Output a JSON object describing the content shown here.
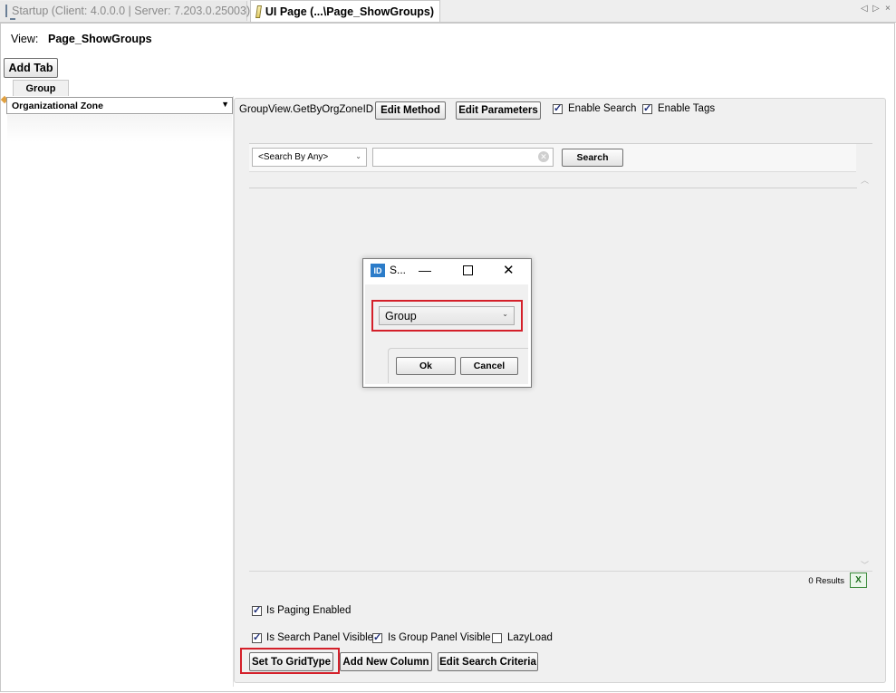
{
  "tabs": {
    "startup": "Startup (Client: 4.0.0.0 | Server: 7.203.0.25003)",
    "ui_page": "UI Page (...\\Page_ShowGroups)"
  },
  "view": {
    "label": "View:",
    "value": "Page_ShowGroups"
  },
  "add_tab": "Add Tab",
  "inner_tab": "Group",
  "org_zone": "Organizational Zone",
  "method": {
    "name": "GroupView.GetByOrgZoneID",
    "edit_method": "Edit Method",
    "edit_parameters": "Edit Parameters",
    "enable_search": "Enable Search",
    "enable_tags": "Enable Tags",
    "enable_search_checked": true,
    "enable_tags_checked": true
  },
  "grid": {
    "search_by": "<Search By Any>",
    "search_button": "Search",
    "results": "0 Results"
  },
  "dialog": {
    "icon": "ID",
    "title": "S...",
    "selected": "Group",
    "ok": "Ok",
    "cancel": "Cancel"
  },
  "options": {
    "paging": "Is Paging Enabled",
    "search_panel": "Is Search Panel Visible",
    "group_panel": "Is Group Panel Visible",
    "lazy_load": "LazyLoad",
    "paging_checked": true,
    "search_panel_checked": true,
    "group_panel_checked": true,
    "lazy_load_checked": false
  },
  "buttons": {
    "set_grid_type": "Set To GridType",
    "add_new_column": "Add New Column",
    "edit_search_criteria": "Edit Search Criteria"
  },
  "colors": {
    "highlight": "#d4202a",
    "panel_bg": "#f0f0f0"
  },
  "icons": [
    "monitor-icon",
    "page-icon",
    "dropdown-arrow-icon",
    "clear-icon",
    "excel-export-icon",
    "app-id-icon",
    "minimize-icon",
    "maximize-icon",
    "close-icon"
  ]
}
